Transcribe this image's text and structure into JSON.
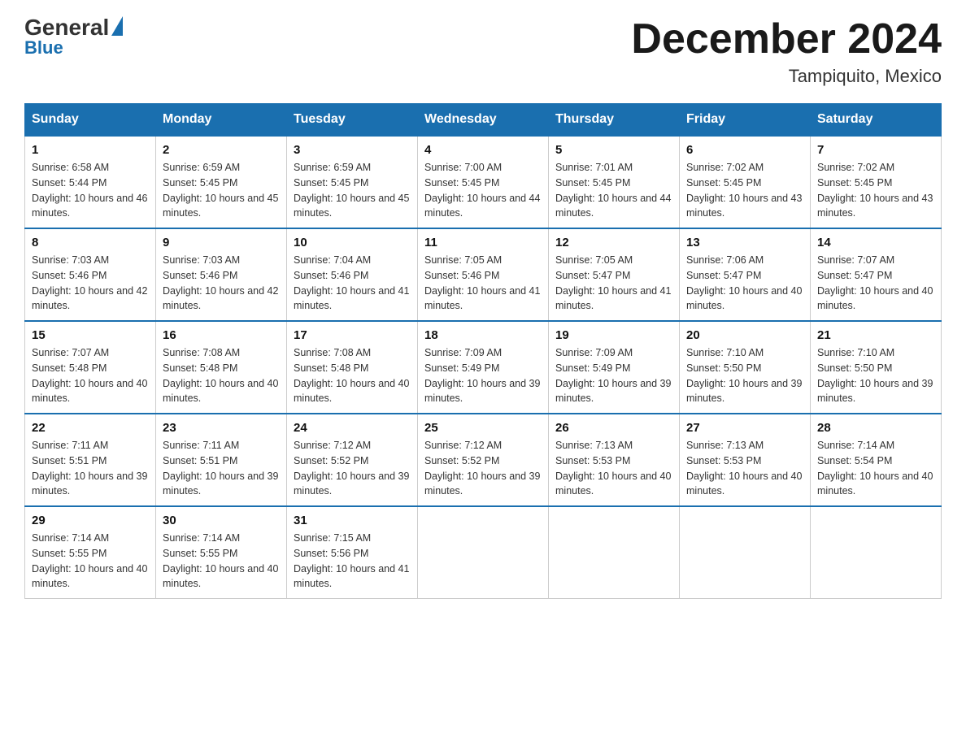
{
  "logo": {
    "general": "General",
    "blue": "Blue"
  },
  "title": {
    "month_year": "December 2024",
    "location": "Tampiquito, Mexico"
  },
  "header_days": [
    "Sunday",
    "Monday",
    "Tuesday",
    "Wednesday",
    "Thursday",
    "Friday",
    "Saturday"
  ],
  "weeks": [
    [
      {
        "day": "1",
        "sunrise": "6:58 AM",
        "sunset": "5:44 PM",
        "daylight": "10 hours and 46 minutes."
      },
      {
        "day": "2",
        "sunrise": "6:59 AM",
        "sunset": "5:45 PM",
        "daylight": "10 hours and 45 minutes."
      },
      {
        "day": "3",
        "sunrise": "6:59 AM",
        "sunset": "5:45 PM",
        "daylight": "10 hours and 45 minutes."
      },
      {
        "day": "4",
        "sunrise": "7:00 AM",
        "sunset": "5:45 PM",
        "daylight": "10 hours and 44 minutes."
      },
      {
        "day": "5",
        "sunrise": "7:01 AM",
        "sunset": "5:45 PM",
        "daylight": "10 hours and 44 minutes."
      },
      {
        "day": "6",
        "sunrise": "7:02 AM",
        "sunset": "5:45 PM",
        "daylight": "10 hours and 43 minutes."
      },
      {
        "day": "7",
        "sunrise": "7:02 AM",
        "sunset": "5:45 PM",
        "daylight": "10 hours and 43 minutes."
      }
    ],
    [
      {
        "day": "8",
        "sunrise": "7:03 AM",
        "sunset": "5:46 PM",
        "daylight": "10 hours and 42 minutes."
      },
      {
        "day": "9",
        "sunrise": "7:03 AM",
        "sunset": "5:46 PM",
        "daylight": "10 hours and 42 minutes."
      },
      {
        "day": "10",
        "sunrise": "7:04 AM",
        "sunset": "5:46 PM",
        "daylight": "10 hours and 41 minutes."
      },
      {
        "day": "11",
        "sunrise": "7:05 AM",
        "sunset": "5:46 PM",
        "daylight": "10 hours and 41 minutes."
      },
      {
        "day": "12",
        "sunrise": "7:05 AM",
        "sunset": "5:47 PM",
        "daylight": "10 hours and 41 minutes."
      },
      {
        "day": "13",
        "sunrise": "7:06 AM",
        "sunset": "5:47 PM",
        "daylight": "10 hours and 40 minutes."
      },
      {
        "day": "14",
        "sunrise": "7:07 AM",
        "sunset": "5:47 PM",
        "daylight": "10 hours and 40 minutes."
      }
    ],
    [
      {
        "day": "15",
        "sunrise": "7:07 AM",
        "sunset": "5:48 PM",
        "daylight": "10 hours and 40 minutes."
      },
      {
        "day": "16",
        "sunrise": "7:08 AM",
        "sunset": "5:48 PM",
        "daylight": "10 hours and 40 minutes."
      },
      {
        "day": "17",
        "sunrise": "7:08 AM",
        "sunset": "5:48 PM",
        "daylight": "10 hours and 40 minutes."
      },
      {
        "day": "18",
        "sunrise": "7:09 AM",
        "sunset": "5:49 PM",
        "daylight": "10 hours and 39 minutes."
      },
      {
        "day": "19",
        "sunrise": "7:09 AM",
        "sunset": "5:49 PM",
        "daylight": "10 hours and 39 minutes."
      },
      {
        "day": "20",
        "sunrise": "7:10 AM",
        "sunset": "5:50 PM",
        "daylight": "10 hours and 39 minutes."
      },
      {
        "day": "21",
        "sunrise": "7:10 AM",
        "sunset": "5:50 PM",
        "daylight": "10 hours and 39 minutes."
      }
    ],
    [
      {
        "day": "22",
        "sunrise": "7:11 AM",
        "sunset": "5:51 PM",
        "daylight": "10 hours and 39 minutes."
      },
      {
        "day": "23",
        "sunrise": "7:11 AM",
        "sunset": "5:51 PM",
        "daylight": "10 hours and 39 minutes."
      },
      {
        "day": "24",
        "sunrise": "7:12 AM",
        "sunset": "5:52 PM",
        "daylight": "10 hours and 39 minutes."
      },
      {
        "day": "25",
        "sunrise": "7:12 AM",
        "sunset": "5:52 PM",
        "daylight": "10 hours and 39 minutes."
      },
      {
        "day": "26",
        "sunrise": "7:13 AM",
        "sunset": "5:53 PM",
        "daylight": "10 hours and 40 minutes."
      },
      {
        "day": "27",
        "sunrise": "7:13 AM",
        "sunset": "5:53 PM",
        "daylight": "10 hours and 40 minutes."
      },
      {
        "day": "28",
        "sunrise": "7:14 AM",
        "sunset": "5:54 PM",
        "daylight": "10 hours and 40 minutes."
      }
    ],
    [
      {
        "day": "29",
        "sunrise": "7:14 AM",
        "sunset": "5:55 PM",
        "daylight": "10 hours and 40 minutes."
      },
      {
        "day": "30",
        "sunrise": "7:14 AM",
        "sunset": "5:55 PM",
        "daylight": "10 hours and 40 minutes."
      },
      {
        "day": "31",
        "sunrise": "7:15 AM",
        "sunset": "5:56 PM",
        "daylight": "10 hours and 41 minutes."
      },
      null,
      null,
      null,
      null
    ]
  ]
}
